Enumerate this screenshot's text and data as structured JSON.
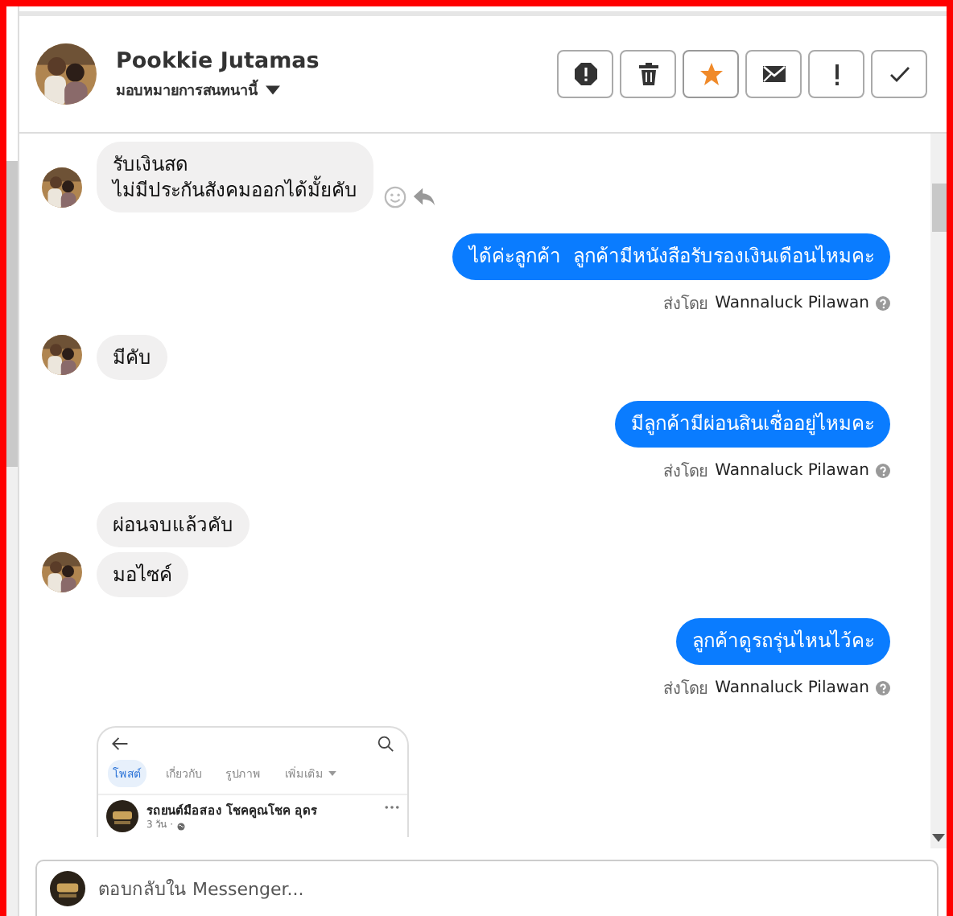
{
  "header": {
    "name": "Pookkie Jutamas",
    "assign_label": "มอบหมายการสนทนานี้",
    "actions": [
      {
        "kind": "spam",
        "active": false
      },
      {
        "kind": "delete",
        "active": false
      },
      {
        "kind": "star",
        "active": true
      },
      {
        "kind": "unread",
        "active": false
      },
      {
        "kind": "follow-up",
        "active": false
      },
      {
        "kind": "done",
        "active": false
      }
    ]
  },
  "messages": [
    {
      "kind": "incoming",
      "show_actions": true,
      "bubbles": [
        "รับเงินสด\nไม่มีประกันสังคมออกได้มั้ยคับ"
      ]
    },
    {
      "kind": "outgoing",
      "text": "ได้ค่ะลูกค้า  ลูกค้ามีหนังสือรับรองเงินเดือนไหมคะ",
      "sent_by": "ส่งโดย",
      "sender": "Wannaluck Pilawan"
    },
    {
      "kind": "incoming",
      "show_actions": false,
      "bubbles": [
        "มีคับ"
      ]
    },
    {
      "kind": "outgoing",
      "text": "มีลูกค้ามีผ่อนสินเชื่ออยู่ไหมคะ",
      "sent_by": "ส่งโดย",
      "sender": "Wannaluck Pilawan"
    },
    {
      "kind": "incoming",
      "show_actions": false,
      "bubbles": [
        "ผ่อนจบแล้วคับ",
        "มอไซค์"
      ]
    },
    {
      "kind": "outgoing",
      "text": "ลูกค้าดูรถรุ่นไหนไว้คะ",
      "sent_by": "ส่งโดย",
      "sender": "Wannaluck Pilawan"
    },
    {
      "kind": "screenshot",
      "tabs": [
        {
          "label": "โพสต์",
          "selected": true
        },
        {
          "label": "เกี่ยวกับ",
          "selected": false
        },
        {
          "label": "รูปภาพ",
          "selected": false
        },
        {
          "label": "เพิ่มเติม",
          "selected": false
        }
      ],
      "post_author": "รถยนต์มือสอง โชคคูณโชค อุดร",
      "post_time": "3 วัน ·"
    }
  ],
  "reply": {
    "placeholder": "ตอบกลับใน Messenger..."
  }
}
